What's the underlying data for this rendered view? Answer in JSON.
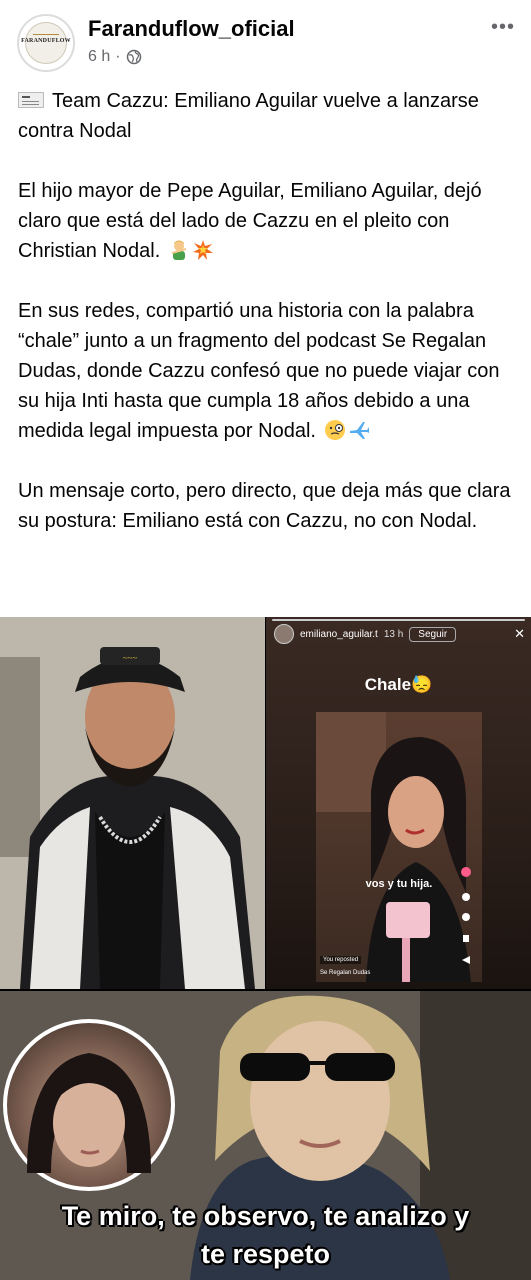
{
  "post": {
    "page_name": "Faranduflow_oficial",
    "avatar_text": "FARANDUFLOW",
    "time": "6 h",
    "separator": "·",
    "more": "•••",
    "paragraphs": [
      "Team Cazzu: Emiliano Aguilar vuelve a lanzarse contra Nodal",
      "El hijo mayor de Pepe Aguilar, Emiliano Aguilar, dejó claro que está del lado de Cazzu en el pleito con Christian Nodal.",
      "En sus redes, compartió una historia con la palabra “chale” junto a un fragmento del podcast Se Regalan Dudas, donde Cazzu confesó que no puede viajar con su hija Inti hasta que cumpla 18 años debido a una medida legal impuesta por Nodal.",
      "Un mensaje corto, pero directo, que deja más que clara su postura: Emiliano está con Cazzu, no con Nodal."
    ]
  },
  "story": {
    "username": "emiliano_aguilar.t",
    "time": "13 h",
    "follow_label": "Seguir",
    "close": "✕",
    "caption": "Chale😓",
    "video_text": "vos y tu hija.",
    "reposted": "You reposted",
    "podcast": "Se Regalan Dudas"
  },
  "meme": {
    "caption_line1": "Te miro, te observo, te analizo y",
    "caption_line2": "te respeto"
  }
}
